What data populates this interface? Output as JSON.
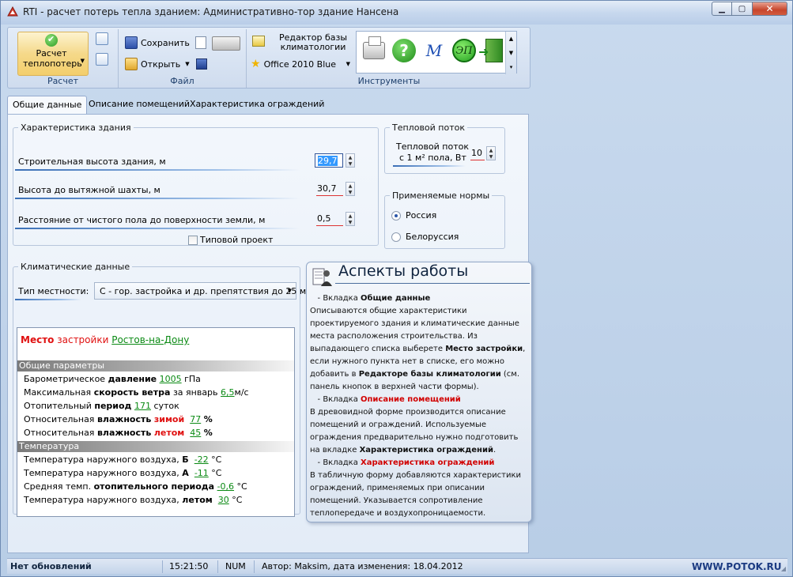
{
  "window": {
    "title": "RTI - расчет потерь тепла зданием: Административно-тор здание Нансена",
    "minimize": "▁",
    "maximize": "▢",
    "close": "✕"
  },
  "ribbon": {
    "calc": {
      "label": "Расчет теплопотерь",
      "group": "Расчет"
    },
    "file": {
      "save": "Сохранить",
      "open": "Открыть",
      "group": "Файл"
    },
    "climate_db": "Редактор базы климатологии",
    "theme": "Office 2010 Blue",
    "tools_group": "Инструменты",
    "tools": {
      "help": "?",
      "mz": "M",
      "ep": "ЭП"
    }
  },
  "tabs": [
    {
      "label": "Общие данные",
      "active": true
    },
    {
      "label": "Описание помещений",
      "active": false
    },
    {
      "label": "Характеристика ограждений",
      "active": false
    }
  ],
  "building": {
    "legend": "Характеристика здания",
    "height_label": "Строительная высота здания, м",
    "height_value": "29,7",
    "shaft_label": "Высота  до вытяжной шахты, м",
    "shaft_value": "30,7",
    "ground_label": "Расстояние от чистого пола  до поверхности земли, м",
    "ground_value": "0,5",
    "typical_label": "Типовой проект"
  },
  "heat_flow": {
    "legend": "Тепловой поток",
    "label_1": "Тепловой поток",
    "label_2": "с 1 м² пола, Вт",
    "value": "10"
  },
  "norms": {
    "legend": "Применяемые нормы",
    "options": [
      {
        "label": "Россия",
        "selected": true
      },
      {
        "label": "Белоруссия",
        "selected": false
      }
    ]
  },
  "climate": {
    "legend": "Климатические данные",
    "terrain_label": "Тип местности:",
    "terrain_value": "С - гор. застройка и др. препятствия  до 25 м",
    "place_1": "Место",
    "place_2": "застройки",
    "city": "Ростов-на-Дону",
    "general_header": "Общие параметры",
    "pressure": {
      "pre": "Барометрическое",
      "key": "давление",
      "value": "1005",
      "unit": "гПа"
    },
    "wind": {
      "pre": "Максимальная",
      "key": "скорость ветра",
      "mid": "за январь",
      "value": "6,5",
      "unit": "м/с"
    },
    "period": {
      "pre": "Отопительный",
      "key": "период",
      "value": "171",
      "unit": "суток"
    },
    "hum_winter": {
      "pre": "Относительная",
      "key": "влажность",
      "season": "зимой",
      "value": "77",
      "unit": "%"
    },
    "hum_summer": {
      "pre": "Относительная",
      "key": "влажность",
      "season": "летом",
      "value": "45",
      "unit": "%"
    },
    "temp_header": "Температура",
    "t_b": {
      "pre": "Температура наружного воздуха,",
      "key": "Б",
      "value": "-22",
      "unit": "°C"
    },
    "t_a": {
      "pre": "Температура наружного воздуха,",
      "key": "А",
      "value": "-11",
      "unit": "°C"
    },
    "t_avg": {
      "pre": "Средняя темп.",
      "key": "отопительного периода",
      "value": "-0,6",
      "unit": "°C"
    },
    "t_summer": {
      "pre": "Температура наружного воздуха,",
      "key": "летом",
      "value": "30",
      "unit": "°C"
    }
  },
  "aspects": {
    "title": "Аспекты работы",
    "p1_pre": " - Вкладка",
    "p1_tab": "Общие  данные",
    "p1_text_a": "Описываются общие  характеристики проектируемого здания и климатические данные места расположения строительства. Из выпадающего списка выберете ",
    "p1_bold": "Место застройки",
    "p1_text_b": ", если нужного пункта нет в списке, его можно добавить в ",
    "p1_bold2": "Редакторе базы климатологии",
    "p1_text_c": " (см. панель  кнопок в верхней части формы).",
    "p2_pre": " - Вкладка",
    "p2_tab": "Описание   помещений",
    "p2_text_a": "В древовидной форме производится описание помещений и ограждений. Используемые ограждения  предварительно нужно подготовить на вкладке ",
    "p2_bold": "Характеристика ограждений",
    "p2_text_b": ".",
    "p3_pre": " -  Вкладка",
    "p3_tab": "Характеристика ограждений",
    "p3_text": "В табличную форму добавляются характеристики ограждений, применяемых при описании помещений. Указывается сопротивление теплопередаче и воздухопроницаемости."
  },
  "status": {
    "updates": "Нет обновлений",
    "time": "15:21:50",
    "num": "NUM",
    "author": "Автор: Maksim, дата изменения: 18.04.2012"
  },
  "watermark": "WWW.POTOK.RU"
}
